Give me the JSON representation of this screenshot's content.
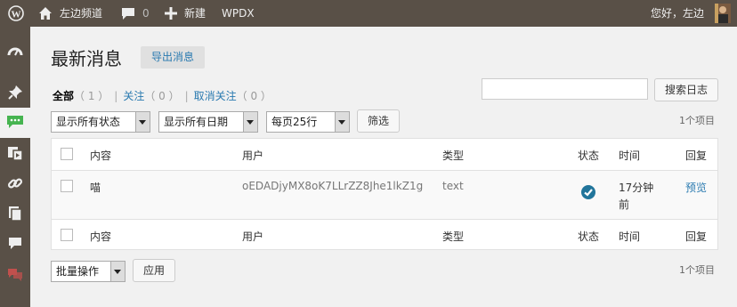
{
  "adminbar": {
    "site_name": "左边频道",
    "comments_count": "0",
    "new_label": "新建",
    "plugin_label": "WPDX",
    "greeting": "您好，左边"
  },
  "page": {
    "title": "最新消息",
    "export_label": "导出消息"
  },
  "views": [
    {
      "label": "全部",
      "count": "（ 1 ）"
    },
    {
      "label": "关注",
      "count": "（ 0 ）"
    },
    {
      "label": "取消关注",
      "count": "（ 0 ）"
    }
  ],
  "search": {
    "button_label": "搜索日志",
    "value": ""
  },
  "filters": {
    "status_selected": "显示所有状态",
    "date_selected": "显示所有日期",
    "per_page_selected": "每页25行",
    "filter_button": "筛选"
  },
  "items_count": "1个项目",
  "table": {
    "columns": [
      "内容",
      "用户",
      "类型",
      "状态",
      "时间",
      "回复"
    ],
    "rows": [
      {
        "content": "喵",
        "user": "oEDADjyMX8oK7LLrZZ8Jhe1lkZ1g",
        "type": "text",
        "status": "checked",
        "time_line1": "17分钟",
        "time_line2": "前",
        "reply": "预览"
      }
    ]
  },
  "bulk": {
    "selected": "批量操作",
    "apply_label": "应用"
  },
  "colors": {
    "adminbar": "#595047",
    "link": "#2a7ab0",
    "active_menu": "#46b450",
    "status_icon": "#21759b"
  }
}
